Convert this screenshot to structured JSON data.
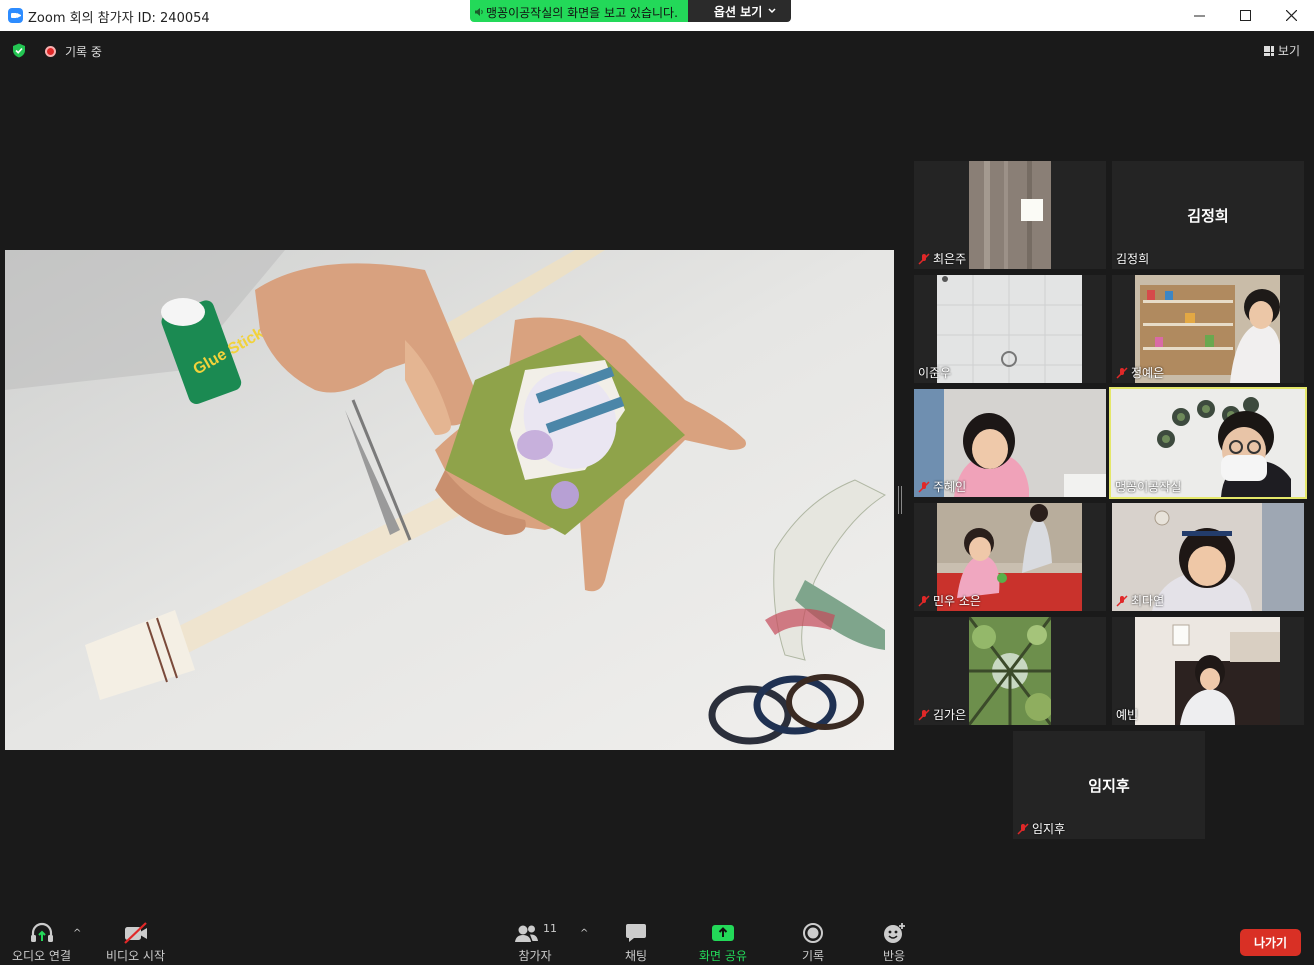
{
  "window": {
    "title": "Zoom 회의 참가자 ID: 240054",
    "minimize_icon": "minimize-icon",
    "maximize_icon": "maximize-icon",
    "close_icon": "close-icon"
  },
  "share_banner": {
    "text": "맹꽁이공작실의 화면을 보고 있습니다.",
    "options_label": "옵션 보기"
  },
  "top": {
    "recording_label": "기록 중",
    "view_label": "보기"
  },
  "participants": [
    {
      "name": "최은주",
      "muted": true,
      "has_video": true
    },
    {
      "name": "김정희",
      "muted": false,
      "has_video": false,
      "display": "김정희"
    },
    {
      "name": "이준우",
      "muted": false,
      "has_video": true
    },
    {
      "name": "정예은",
      "muted": true,
      "has_video": true
    },
    {
      "name": "주혜인",
      "muted": true,
      "has_video": true
    },
    {
      "name": "맹꽁이공작실",
      "muted": false,
      "has_video": true,
      "active": true
    },
    {
      "name": "민우 소은",
      "muted": true,
      "has_video": true
    },
    {
      "name": "최다연",
      "muted": true,
      "has_video": true
    },
    {
      "name": "김가은",
      "muted": true,
      "has_video": true
    },
    {
      "name": "예빈",
      "muted": false,
      "has_video": true
    },
    {
      "name": "임지후",
      "muted": true,
      "has_video": false,
      "display": "임지후"
    }
  ],
  "main_video": {
    "glue_stick_text": "Glue Stick"
  },
  "toolbar": {
    "audio_label": "오디오 연결",
    "video_label": "비디오 시작",
    "participants_label": "참가자",
    "participants_count": "11",
    "chat_label": "채팅",
    "share_label": "화면 공유",
    "record_label": "기록",
    "reactions_label": "반응",
    "leave_label": "나가기"
  },
  "colors": {
    "share_green": "#23d959",
    "leave_red": "#d93025",
    "active_speaker": "#e5e86a",
    "mute_red": "#e02828"
  }
}
